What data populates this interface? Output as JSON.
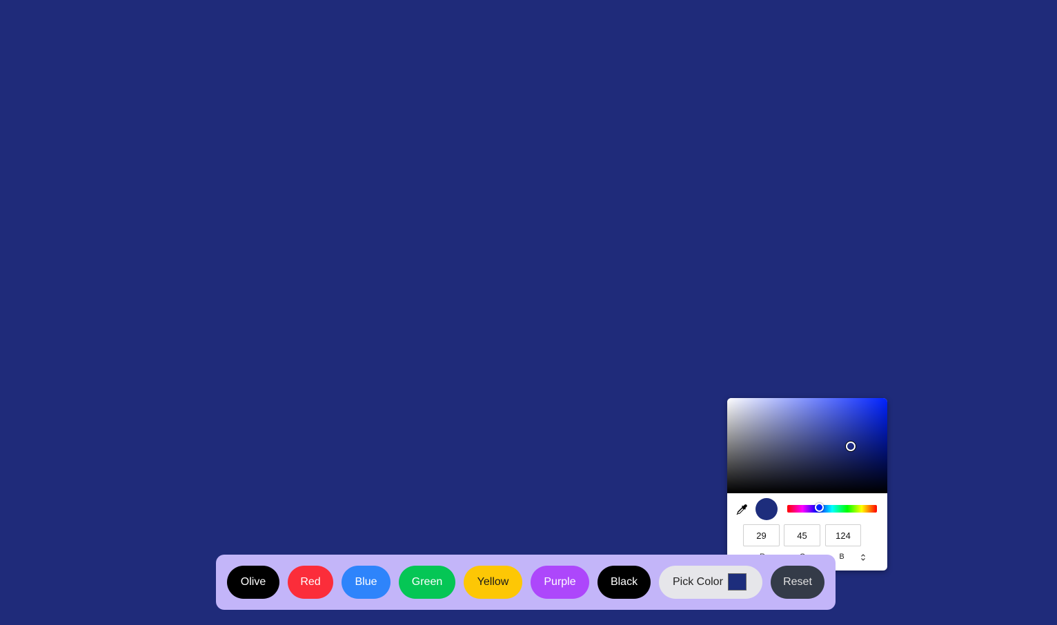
{
  "page": {
    "background_color": "#1f2b7a"
  },
  "toolbar": {
    "buttons": {
      "olive": "Olive",
      "red": "Red",
      "blue": "Blue",
      "green": "Green",
      "yellow": "Yellow",
      "purple": "Purple",
      "black": "Black",
      "pick_color": "Pick Color",
      "reset": "Reset"
    },
    "pick_swatch_color": "#1d2d7c"
  },
  "color_picker": {
    "hue_color": "#0022ff",
    "selected_color": "#1d2d7c",
    "hue_fraction": 0.355,
    "saturation": 0.77,
    "value": 0.49,
    "rgb": {
      "r": "29",
      "g": "45",
      "b": "124"
    },
    "labels": {
      "r": "R",
      "g": "G",
      "b": "B"
    },
    "icons": {
      "eyedropper": "eyedropper-icon",
      "mode_toggle": "up-down-arrows-icon"
    }
  }
}
